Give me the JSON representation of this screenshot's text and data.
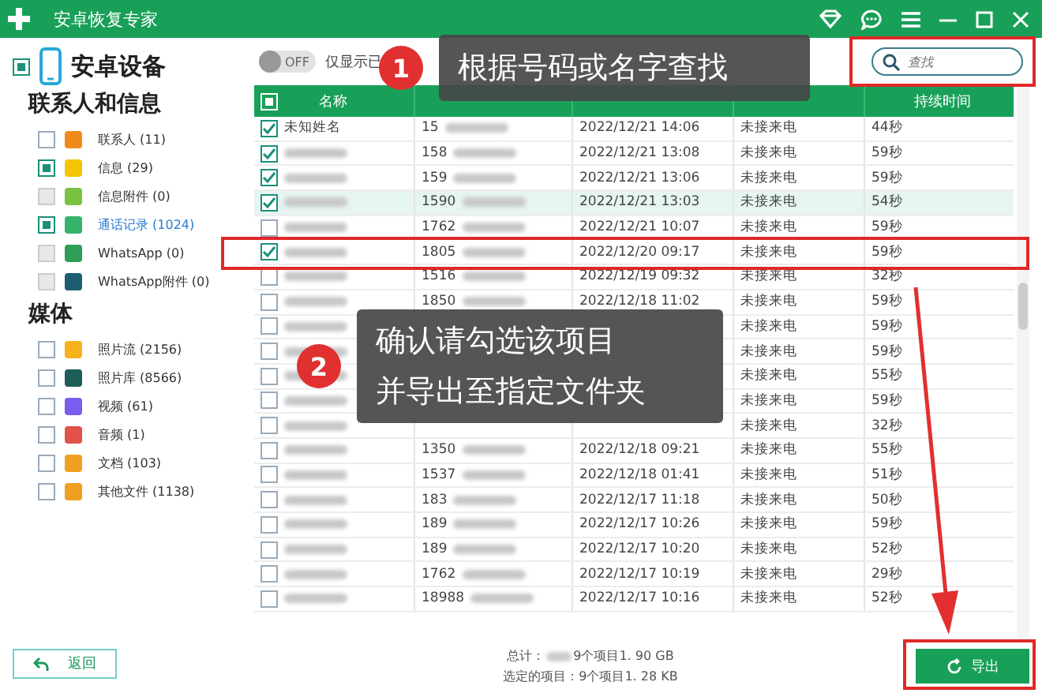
{
  "window": {
    "title": "安卓恢复专家"
  },
  "sidebar": {
    "device": {
      "label": "安卓设备",
      "checked": true
    },
    "sections": [
      {
        "title": "联系人和信息",
        "items": [
          {
            "label": "联系人 (11)",
            "checked": false,
            "disabled": false,
            "selected": false,
            "color": "#f08a1c"
          },
          {
            "label": "信息 (29)",
            "checked": true,
            "disabled": false,
            "selected": false,
            "color": "#f5c400"
          },
          {
            "label": "信息附件 (0)",
            "checked": false,
            "disabled": true,
            "selected": false,
            "color": "#7cc242"
          },
          {
            "label": "通话记录 (1024)",
            "checked": true,
            "disabled": false,
            "selected": true,
            "color": "#35b36b"
          },
          {
            "label": "WhatsApp (0)",
            "checked": false,
            "disabled": true,
            "selected": false,
            "color": "#2e9e57"
          },
          {
            "label": "WhatsApp附件 (0)",
            "checked": false,
            "disabled": true,
            "selected": false,
            "color": "#1f5d73"
          }
        ]
      },
      {
        "title": "媒体",
        "items": [
          {
            "label": "照片流 (2156)",
            "checked": false,
            "disabled": false,
            "selected": false,
            "color": "#f5b21c"
          },
          {
            "label": "照片库 (8566)",
            "checked": false,
            "disabled": false,
            "selected": false,
            "color": "#1f5d5a"
          },
          {
            "label": "视频 (61)",
            "checked": false,
            "disabled": false,
            "selected": false,
            "color": "#7b5cf0"
          },
          {
            "label": "音频 (1)",
            "checked": false,
            "disabled": false,
            "selected": false,
            "color": "#e0524a"
          },
          {
            "label": "文档 (103)",
            "checked": false,
            "disabled": false,
            "selected": false,
            "color": "#f0a020"
          },
          {
            "label": "其他文件 (1138)",
            "checked": false,
            "disabled": false,
            "selected": false,
            "color": "#f0a020"
          }
        ]
      }
    ]
  },
  "toolbar": {
    "toggle": {
      "label": "OFF",
      "on": false
    },
    "filter_label": "仅显示已",
    "search": {
      "placeholder": "查找"
    }
  },
  "table": {
    "all_checked": true,
    "columns": {
      "name": "名称",
      "duration": "持续时间"
    },
    "rows": [
      {
        "name": "未知姓名",
        "phone": "15",
        "date": "2022/12/21 14:06",
        "type": "未接来电",
        "duration": "44秒",
        "checked": true,
        "selected": false
      },
      {
        "phone": "158",
        "date": "2022/12/21 13:08",
        "type": "未接来电",
        "duration": "59秒",
        "checked": true,
        "selected": false
      },
      {
        "phone": "159",
        "date": "2022/12/21 13:06",
        "type": "未接来电",
        "duration": "59秒",
        "checked": true,
        "selected": false
      },
      {
        "phone": "1590",
        "date": "2022/12/21 13:03",
        "type": "未接来电",
        "duration": "54秒",
        "checked": true,
        "selected": true
      },
      {
        "phone": "1762",
        "date": "2022/12/21 10:07",
        "type": "未接来电",
        "duration": "59秒",
        "checked": false,
        "selected": false
      },
      {
        "phone": "1805",
        "date": "2022/12/20 09:17",
        "type": "未接来电",
        "duration": "59秒",
        "checked": true,
        "selected": false
      },
      {
        "phone": "1516",
        "date": "2022/12/19 09:32",
        "type": "未接来电",
        "duration": "32秒",
        "checked": false,
        "selected": false
      },
      {
        "phone": "1850",
        "date": "2022/12/18 11:02",
        "type": "未接来电",
        "duration": "59秒",
        "checked": false,
        "selected": false
      },
      {
        "type": "未接来电",
        "duration": "59秒",
        "checked": false,
        "selected": false
      },
      {
        "type": "未接来电",
        "duration": "59秒",
        "checked": false,
        "selected": false
      },
      {
        "type": "未接来电",
        "duration": "55秒",
        "checked": false,
        "selected": false
      },
      {
        "type": "未接来电",
        "duration": "59秒",
        "checked": false,
        "selected": false
      },
      {
        "type": "未接来电",
        "duration": "32秒",
        "checked": false,
        "selected": false
      },
      {
        "phone": "1350",
        "date": "2022/12/18 09:21",
        "type": "未接来电",
        "duration": "55秒",
        "checked": false,
        "selected": false
      },
      {
        "phone": "1537",
        "date": "2022/12/18 01:41",
        "type": "未接来电",
        "duration": "51秒",
        "checked": false,
        "selected": false
      },
      {
        "phone": "183",
        "date": "2022/12/17 11:18",
        "type": "未接来电",
        "duration": "50秒",
        "checked": false,
        "selected": false
      },
      {
        "phone": "189",
        "date": "2022/12/17 10:26",
        "type": "未接来电",
        "duration": "59秒",
        "checked": false,
        "selected": false
      },
      {
        "phone": "189",
        "date": "2022/12/17 10:20",
        "type": "未接来电",
        "duration": "52秒",
        "checked": false,
        "selected": false
      },
      {
        "phone": "1762",
        "date": "2022/12/17 10:19",
        "type": "未接来电",
        "duration": "29秒",
        "checked": false,
        "selected": false
      },
      {
        "phone": "18988",
        "date": "2022/12/17 10:16",
        "type": "未接来电",
        "duration": "52秒",
        "checked": false,
        "selected": false
      }
    ]
  },
  "footer": {
    "back": "返回",
    "total_label": "总计：",
    "total_value": "9个项目1. 90 GB",
    "selected_line": "选定的项目：9个项目1. 28 KB",
    "export": "导出"
  },
  "annotations": [
    {
      "number": "1",
      "lines": [
        "根据号码或名字查找"
      ]
    },
    {
      "number": "2",
      "lines": [
        "确认请勾选该项目",
        "并导出至指定文件夹"
      ]
    }
  ]
}
